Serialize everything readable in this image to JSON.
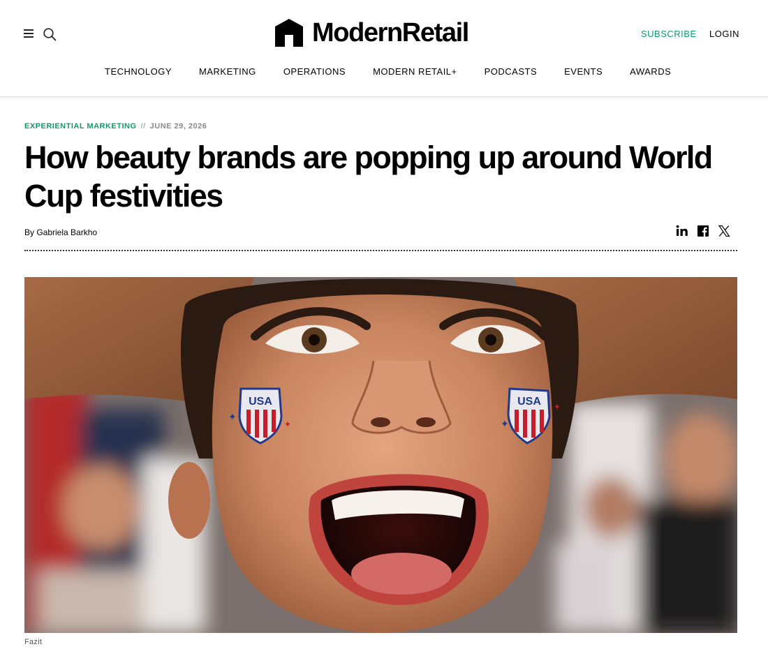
{
  "header": {
    "brand_name": "ModernRetail",
    "subscribe_label": "SUBSCRIBE",
    "login_label": "LOGIN",
    "menu_icon": "hamburger-menu-icon",
    "search_icon": "search-icon",
    "accent_color": "#119a6a"
  },
  "nav": {
    "items": [
      {
        "label": "TECHNOLOGY"
      },
      {
        "label": "MARKETING"
      },
      {
        "label": "OPERATIONS"
      },
      {
        "label": "MODERN RETAIL+"
      },
      {
        "label": "PODCASTS"
      },
      {
        "label": "EVENTS"
      },
      {
        "label": "AWARDS"
      }
    ]
  },
  "article": {
    "category": "EXPERIENTIAL MARKETING",
    "separator": "//",
    "date": "JUNE 29, 2026",
    "headline": "How beauty brands are popping up around World Cup festivities",
    "byline": "By Gabriela Barkho",
    "share": {
      "icons": [
        "linkedin-icon",
        "facebook-icon",
        "x-icon"
      ]
    },
    "hero_image": {
      "sticker_text": "USA",
      "caption": "Fazit"
    }
  }
}
